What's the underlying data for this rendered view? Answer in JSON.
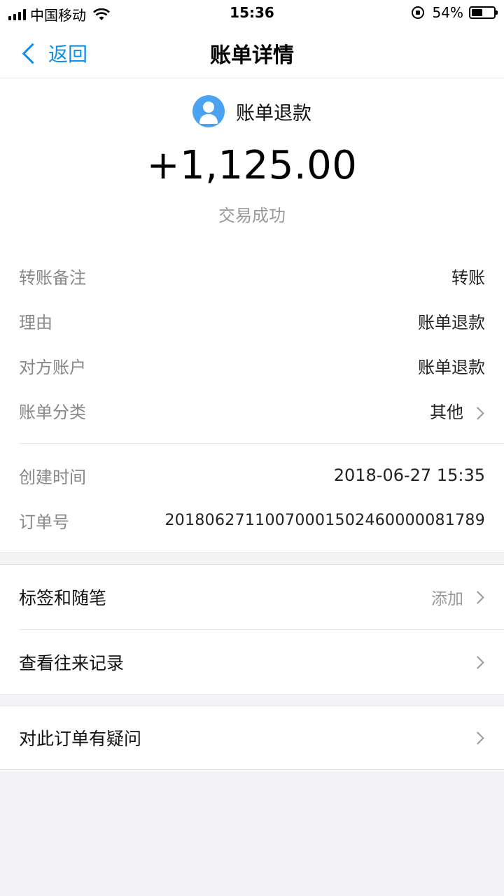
{
  "status_bar": {
    "carrier": "中国移动",
    "time": "15:36",
    "battery": "54%",
    "battery_level": 0.54
  },
  "nav": {
    "back_label": "返回",
    "title": "账单详情"
  },
  "summary": {
    "merchant_name": "账单退款",
    "amount": "+1,125.00",
    "status": "交易成功"
  },
  "details": [
    {
      "label": "转账备注",
      "value": "转账"
    },
    {
      "label": "理由",
      "value": "账单退款"
    },
    {
      "label": "对方账户",
      "value": "账单退款"
    },
    {
      "label": "账单分类",
      "value": "其他"
    },
    {
      "label": "创建时间",
      "value": "2018-06-27 15:35"
    },
    {
      "label": "订单号",
      "value": "20180627110070001502460000081789"
    }
  ],
  "notes": {
    "label": "标签和随笔",
    "action": "添加"
  },
  "history": {
    "label": "查看往来记录"
  },
  "dispute": {
    "label": "对此订单有疑问"
  },
  "icons": {
    "back": "chevron-left-icon",
    "avatar": "user-avatar-icon",
    "chevron": "chevron-right-icon",
    "wifi": "wifi-icon",
    "battery": "battery-icon",
    "rotation_lock": "rotation-lock-icon"
  },
  "colors": {
    "accent": "#108ee9",
    "avatar_bg": "#4aa3f0",
    "label_gray": "#888888"
  }
}
